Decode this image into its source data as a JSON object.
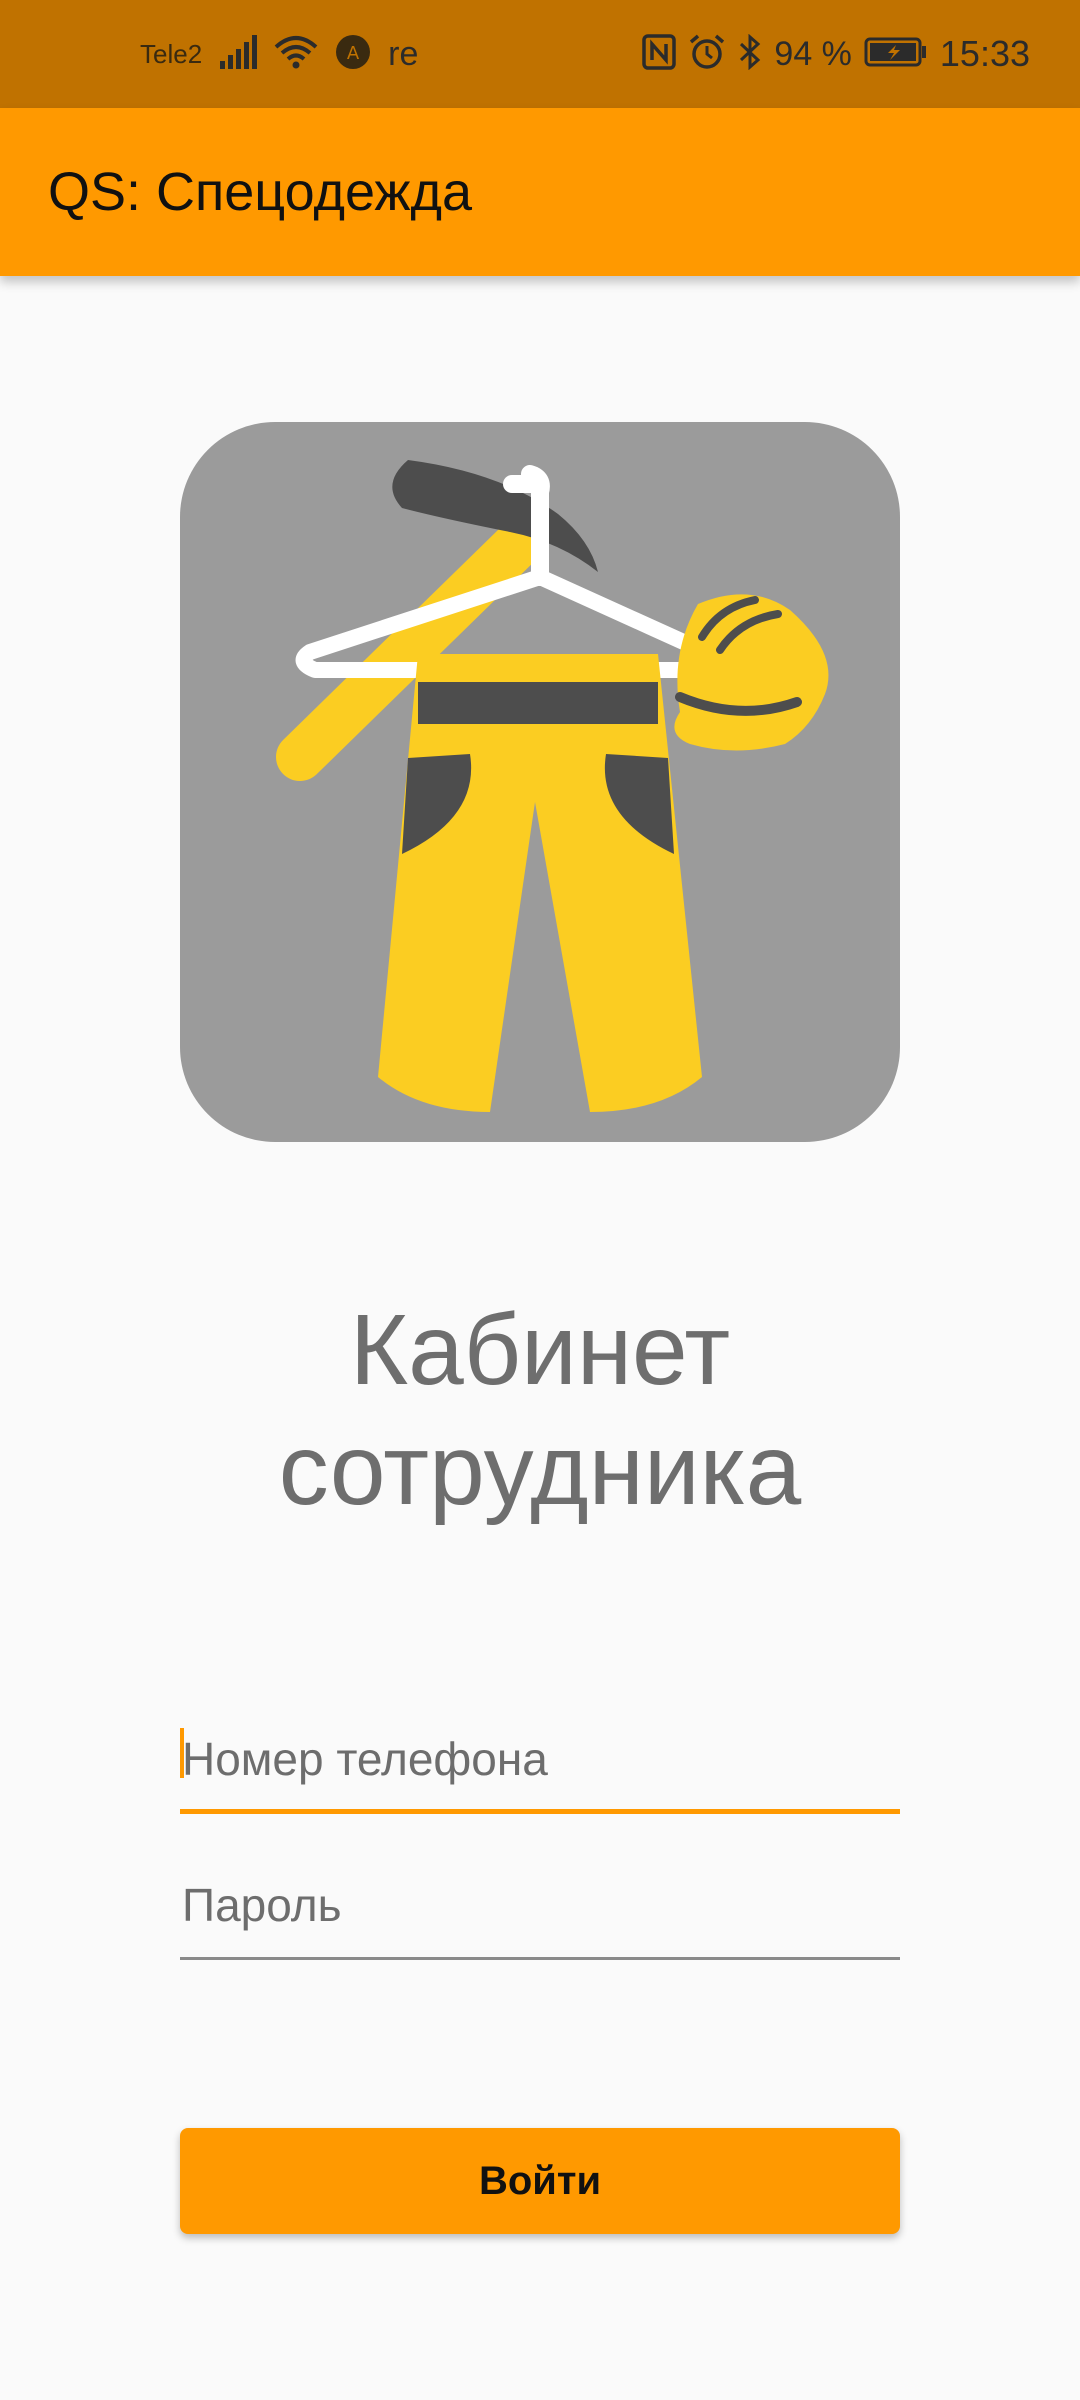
{
  "status_bar": {
    "carrier": "Tele2",
    "extra_label": "re",
    "battery_percent": "94 %",
    "time": "15:33",
    "icons": [
      "signal-icon",
      "wifi-icon",
      "app-notification-icon",
      "nfc-icon",
      "alarm-icon",
      "bluetooth-icon",
      "battery-charging-icon"
    ]
  },
  "app_bar": {
    "title": "QS: Спецодежда"
  },
  "logo": {
    "icon": "workwear-logo-icon",
    "colors": {
      "background": "#9b9b9b",
      "yellow": "#fbcd22",
      "dark": "#4d4d4d",
      "white": "#ffffff"
    }
  },
  "heading": {
    "line1": "Кабинет",
    "line2": "сотрудника"
  },
  "form": {
    "phone_placeholder": "Номер телефона",
    "password_placeholder": "Пароль",
    "login_button": "Войти"
  },
  "colors": {
    "accent": "#ff9900",
    "status_bar": "#c07200",
    "background": "#fafafa"
  }
}
